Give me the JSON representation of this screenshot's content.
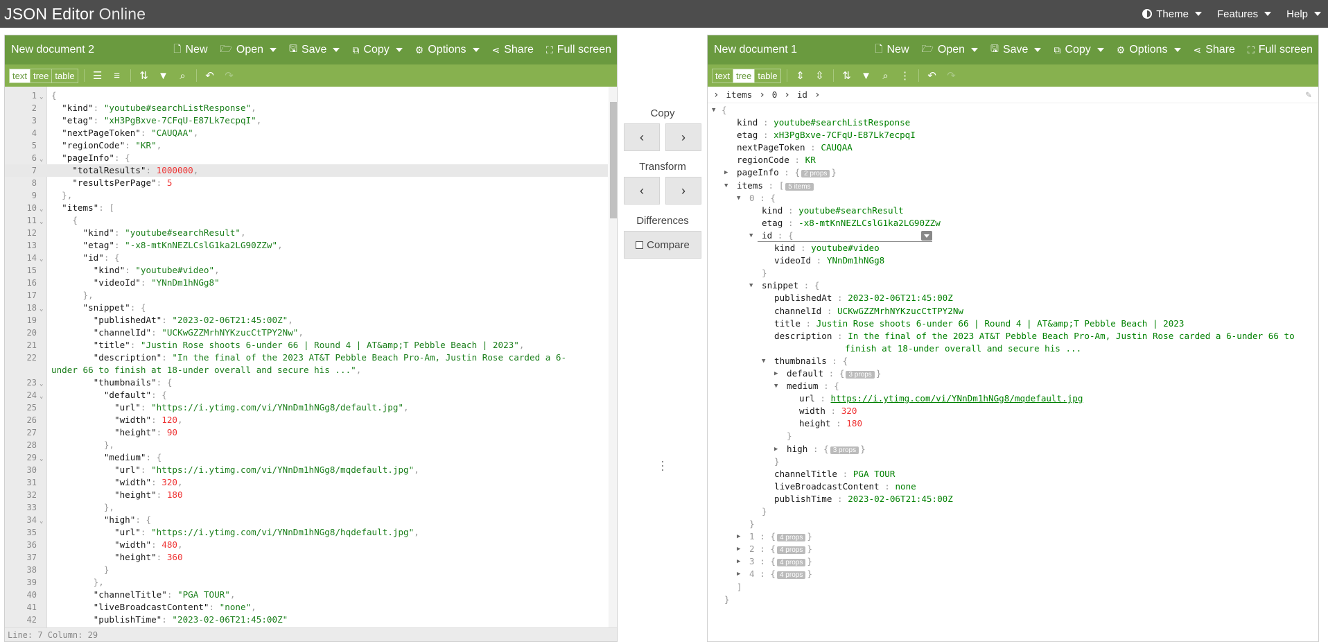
{
  "app": {
    "title_main": "JSON Editor",
    "title_light": "Online"
  },
  "topmenu": {
    "theme": "Theme",
    "features": "Features",
    "help": "Help"
  },
  "left": {
    "doc_title": "New document 2",
    "buttons": {
      "new": "New",
      "open": "Open",
      "save": "Save",
      "copy": "Copy",
      "options": "Options",
      "share": "Share",
      "fullscreen": "Full screen"
    },
    "modes": [
      "text",
      "tree",
      "table"
    ],
    "status": "Line: 7  Column: 29",
    "code_lines": [
      [
        [
          "p",
          "{"
        ]
      ],
      [
        [
          "p",
          "  "
        ],
        [
          "k",
          "\"kind\""
        ],
        [
          "p",
          ": "
        ],
        [
          "s",
          "\"youtube#searchListResponse\""
        ],
        [
          "p",
          ","
        ]
      ],
      [
        [
          "p",
          "  "
        ],
        [
          "k",
          "\"etag\""
        ],
        [
          "p",
          ": "
        ],
        [
          "s",
          "\"xH3PgBxve-7CFqU-E87Lk7ecpqI\""
        ],
        [
          "p",
          ","
        ]
      ],
      [
        [
          "p",
          "  "
        ],
        [
          "k",
          "\"nextPageToken\""
        ],
        [
          "p",
          ": "
        ],
        [
          "s",
          "\"CAUQAA\""
        ],
        [
          "p",
          ","
        ]
      ],
      [
        [
          "p",
          "  "
        ],
        [
          "k",
          "\"regionCode\""
        ],
        [
          "p",
          ": "
        ],
        [
          "s",
          "\"KR\""
        ],
        [
          "p",
          ","
        ]
      ],
      [
        [
          "p",
          "  "
        ],
        [
          "k",
          "\"pageInfo\""
        ],
        [
          "p",
          ": {"
        ]
      ],
      [
        [
          "p",
          "    "
        ],
        [
          "k",
          "\"totalResults\""
        ],
        [
          "p",
          ": "
        ],
        [
          "n",
          "1000000"
        ],
        [
          "p",
          ","
        ]
      ],
      [
        [
          "p",
          "    "
        ],
        [
          "k",
          "\"resultsPerPage\""
        ],
        [
          "p",
          ": "
        ],
        [
          "n",
          "5"
        ]
      ],
      [
        [
          "p",
          "  },"
        ]
      ],
      [
        [
          "p",
          "  "
        ],
        [
          "k",
          "\"items\""
        ],
        [
          "p",
          ": ["
        ]
      ],
      [
        [
          "p",
          "    {"
        ]
      ],
      [
        [
          "p",
          "      "
        ],
        [
          "k",
          "\"kind\""
        ],
        [
          "p",
          ": "
        ],
        [
          "s",
          "\"youtube#searchResult\""
        ],
        [
          "p",
          ","
        ]
      ],
      [
        [
          "p",
          "      "
        ],
        [
          "k",
          "\"etag\""
        ],
        [
          "p",
          ": "
        ],
        [
          "s",
          "\"-x8-mtKnNEZLCslG1ka2LG90ZZw\""
        ],
        [
          "p",
          ","
        ]
      ],
      [
        [
          "p",
          "      "
        ],
        [
          "k",
          "\"id\""
        ],
        [
          "p",
          ": {"
        ]
      ],
      [
        [
          "p",
          "        "
        ],
        [
          "k",
          "\"kind\""
        ],
        [
          "p",
          ": "
        ],
        [
          "s",
          "\"youtube#video\""
        ],
        [
          "p",
          ","
        ]
      ],
      [
        [
          "p",
          "        "
        ],
        [
          "k",
          "\"videoId\""
        ],
        [
          "p",
          ": "
        ],
        [
          "s",
          "\"YNnDm1hNGg8\""
        ]
      ],
      [
        [
          "p",
          "      },"
        ]
      ],
      [
        [
          "p",
          "      "
        ],
        [
          "k",
          "\"snippet\""
        ],
        [
          "p",
          ": {"
        ]
      ],
      [
        [
          "p",
          "        "
        ],
        [
          "k",
          "\"publishedAt\""
        ],
        [
          "p",
          ": "
        ],
        [
          "s",
          "\"2023-02-06T21:45:00Z\""
        ],
        [
          "p",
          ","
        ]
      ],
      [
        [
          "p",
          "        "
        ],
        [
          "k",
          "\"channelId\""
        ],
        [
          "p",
          ": "
        ],
        [
          "s",
          "\"UCKwGZZMrhNYKzucCtTPY2Nw\""
        ],
        [
          "p",
          ","
        ]
      ],
      [
        [
          "p",
          "        "
        ],
        [
          "k",
          "\"title\""
        ],
        [
          "p",
          ": "
        ],
        [
          "s",
          "\"Justin Rose shoots 6-under 66 | Round 4 | AT&amp;T Pebble Beach | 2023\""
        ],
        [
          "p",
          ","
        ]
      ],
      [
        [
          "p",
          "        "
        ],
        [
          "k",
          "\"description\""
        ],
        [
          "p",
          ": "
        ],
        [
          "s",
          "\"In the final of the 2023 AT&T Pebble Beach Pro-Am, Justin Rose carded a 6-"
        ]
      ],
      [
        [
          "s",
          "under 66 to finish at 18-under overall and secure his ...\""
        ],
        [
          "p",
          ","
        ]
      ],
      [
        [
          "p",
          "        "
        ],
        [
          "k",
          "\"thumbnails\""
        ],
        [
          "p",
          ": {"
        ]
      ],
      [
        [
          "p",
          "          "
        ],
        [
          "k",
          "\"default\""
        ],
        [
          "p",
          ": {"
        ]
      ],
      [
        [
          "p",
          "            "
        ],
        [
          "k",
          "\"url\""
        ],
        [
          "p",
          ": "
        ],
        [
          "s",
          "\"https://i.ytimg.com/vi/YNnDm1hNGg8/default.jpg\""
        ],
        [
          "p",
          ","
        ]
      ],
      [
        [
          "p",
          "            "
        ],
        [
          "k",
          "\"width\""
        ],
        [
          "p",
          ": "
        ],
        [
          "n",
          "120"
        ],
        [
          "p",
          ","
        ]
      ],
      [
        [
          "p",
          "            "
        ],
        [
          "k",
          "\"height\""
        ],
        [
          "p",
          ": "
        ],
        [
          "n",
          "90"
        ]
      ],
      [
        [
          "p",
          "          },"
        ]
      ],
      [
        [
          "p",
          "          "
        ],
        [
          "k",
          "\"medium\""
        ],
        [
          "p",
          ": {"
        ]
      ],
      [
        [
          "p",
          "            "
        ],
        [
          "k",
          "\"url\""
        ],
        [
          "p",
          ": "
        ],
        [
          "s",
          "\"https://i.ytimg.com/vi/YNnDm1hNGg8/mqdefault.jpg\""
        ],
        [
          "p",
          ","
        ]
      ],
      [
        [
          "p",
          "            "
        ],
        [
          "k",
          "\"width\""
        ],
        [
          "p",
          ": "
        ],
        [
          "n",
          "320"
        ],
        [
          "p",
          ","
        ]
      ],
      [
        [
          "p",
          "            "
        ],
        [
          "k",
          "\"height\""
        ],
        [
          "p",
          ": "
        ],
        [
          "n",
          "180"
        ]
      ],
      [
        [
          "p",
          "          },"
        ]
      ],
      [
        [
          "p",
          "          "
        ],
        [
          "k",
          "\"high\""
        ],
        [
          "p",
          ": {"
        ]
      ],
      [
        [
          "p",
          "            "
        ],
        [
          "k",
          "\"url\""
        ],
        [
          "p",
          ": "
        ],
        [
          "s",
          "\"https://i.ytimg.com/vi/YNnDm1hNGg8/hqdefault.jpg\""
        ],
        [
          "p",
          ","
        ]
      ],
      [
        [
          "p",
          "            "
        ],
        [
          "k",
          "\"width\""
        ],
        [
          "p",
          ": "
        ],
        [
          "n",
          "480"
        ],
        [
          "p",
          ","
        ]
      ],
      [
        [
          "p",
          "            "
        ],
        [
          "k",
          "\"height\""
        ],
        [
          "p",
          ": "
        ],
        [
          "n",
          "360"
        ]
      ],
      [
        [
          "p",
          "          }"
        ]
      ],
      [
        [
          "p",
          "        },"
        ]
      ],
      [
        [
          "p",
          "        "
        ],
        [
          "k",
          "\"channelTitle\""
        ],
        [
          "p",
          ": "
        ],
        [
          "s",
          "\"PGA TOUR\""
        ],
        [
          "p",
          ","
        ]
      ],
      [
        [
          "p",
          "        "
        ],
        [
          "k",
          "\"liveBroadcastContent\""
        ],
        [
          "p",
          ": "
        ],
        [
          "s",
          "\"none\""
        ],
        [
          "p",
          ","
        ]
      ],
      [
        [
          "p",
          "        "
        ],
        [
          "k",
          "\"publishTime\""
        ],
        [
          "p",
          ": "
        ],
        [
          "s",
          "\"2023-02-06T21:45:00Z\""
        ]
      ]
    ],
    "line_numbers": [
      "1",
      "2",
      "3",
      "4",
      "5",
      "6",
      "7",
      "8",
      "9",
      "10",
      "11",
      "12",
      "13",
      "14",
      "15",
      "16",
      "17",
      "18",
      "19",
      "20",
      "21",
      "22",
      "",
      "23",
      "24",
      "25",
      "26",
      "27",
      "28",
      "29",
      "30",
      "31",
      "32",
      "33",
      "34",
      "35",
      "36",
      "37",
      "38",
      "39",
      "40",
      "41",
      "42"
    ]
  },
  "middle": {
    "copy": "Copy",
    "transform": "Transform",
    "differences": "Differences",
    "compare": "Compare"
  },
  "right": {
    "doc_title": "New document 1",
    "buttons": {
      "new": "New",
      "open": "Open",
      "save": "Save",
      "copy": "Copy",
      "options": "Options",
      "share": "Share",
      "fullscreen": "Full screen"
    },
    "modes": [
      "text",
      "tree",
      "table"
    ],
    "breadcrumb": [
      "items",
      "0",
      "id"
    ],
    "tree": {
      "kind_key": "kind",
      "kind_val": "youtube#searchListResponse",
      "etag_key": "etag",
      "etag_val": "xH3PgBxve-7CFqU-E87Lk7ecpqI",
      "npt_key": "nextPageToken",
      "npt_val": "CAUQAA",
      "rc_key": "regionCode",
      "rc_val": "KR",
      "pageinfo_key": "pageInfo",
      "pageinfo_badge": "2 props",
      "items_key": "items",
      "items_badge": "5 items",
      "i0": "0",
      "i0_kind_key": "kind",
      "i0_kind_val": "youtube#searchResult",
      "i0_etag_key": "etag",
      "i0_etag_val": "-x8-mtKnNEZLCslG1ka2LG90ZZw",
      "id_key": "id",
      "id_kind_key": "kind",
      "id_kind_val": "youtube#video",
      "id_vid_key": "videoId",
      "id_vid_val": "YNnDm1hNGg8",
      "snippet_key": "snippet",
      "pub_key": "publishedAt",
      "pub_val": "2023-02-06T21:45:00Z",
      "ch_key": "channelId",
      "ch_val": "UCKwGZZMrhNYKzucCtTPY2Nw",
      "title_key": "title",
      "title_val": "Justin Rose shoots 6-under 66 | Round 4 | AT&amp;T Pebble Beach | 2023",
      "desc_key": "description",
      "desc_val1": "In the final of the 2023 AT&T Pebble Beach Pro-Am, Justin Rose carded a 6-under 66 to",
      "desc_val2": "finish at 18-under overall and secure his ...",
      "thumbs_key": "thumbnails",
      "default_key": "default",
      "default_badge": "3 props",
      "medium_key": "medium",
      "url_key": "url",
      "url_val": "https://i.ytimg.com/vi/YNnDm1hNGg8/mqdefault.jpg",
      "w_key": "width",
      "w_val": "320",
      "h_key": "height",
      "h_val": "180",
      "high_key": "high",
      "high_badge": "3 props",
      "ct_key": "channelTitle",
      "ct_val": "PGA TOUR",
      "lbc_key": "liveBroadcastContent",
      "lbc_val": "none",
      "pt_key": "publishTime",
      "pt_val": "2023-02-06T21:45:00Z",
      "i1": "1",
      "i2": "2",
      "i3": "3",
      "i4": "4",
      "props4": "4 props"
    }
  }
}
